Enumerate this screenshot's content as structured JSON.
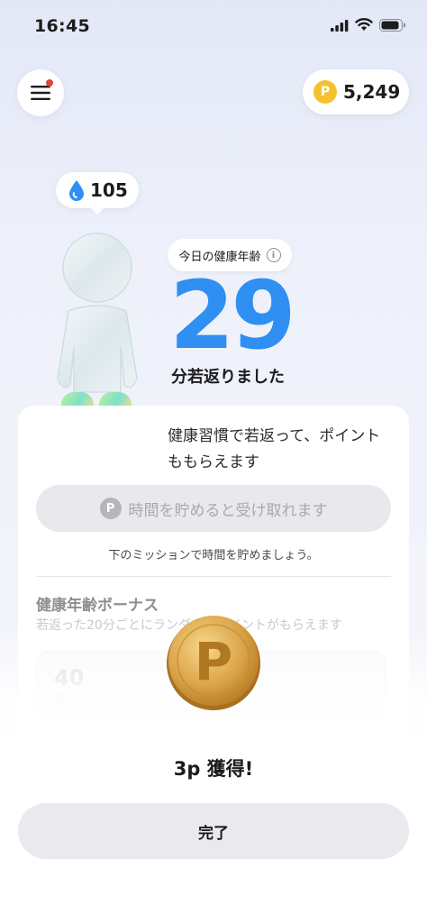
{
  "status_bar": {
    "time": "16:45"
  },
  "header": {
    "points": "5,249",
    "coin_letter": "P"
  },
  "water_badge": {
    "value": "105"
  },
  "health_age": {
    "label": "今日の健康年齢",
    "info_glyph": "i",
    "value": "29",
    "subtitle": "分若返りました"
  },
  "card": {
    "description": "健康習慣で若返って、ポイントももらえます",
    "receive_button": {
      "icon_letter": "P",
      "label": "時間を貯めると受け取れます"
    },
    "mission_note": "下のミッションで時間を貯めましょう。",
    "bonus": {
      "title": "健康年齢ボーナス",
      "subtitle": "若返った20分ごとにランダムでポイントがもらえます",
      "first_value": "40",
      "first_unit": "分"
    }
  },
  "reward": {
    "coin_letter": "P",
    "text": "3p 獲得!",
    "done_label": "完了"
  },
  "colors": {
    "accent_blue": "#2f8ff3",
    "coin_gold": "#f5c12e",
    "notification_red": "#e4413a"
  },
  "icons": [
    "menu-icon",
    "signal-icon",
    "wifi-icon",
    "battery-icon",
    "coin-icon",
    "water-drop-icon",
    "info-icon"
  ]
}
